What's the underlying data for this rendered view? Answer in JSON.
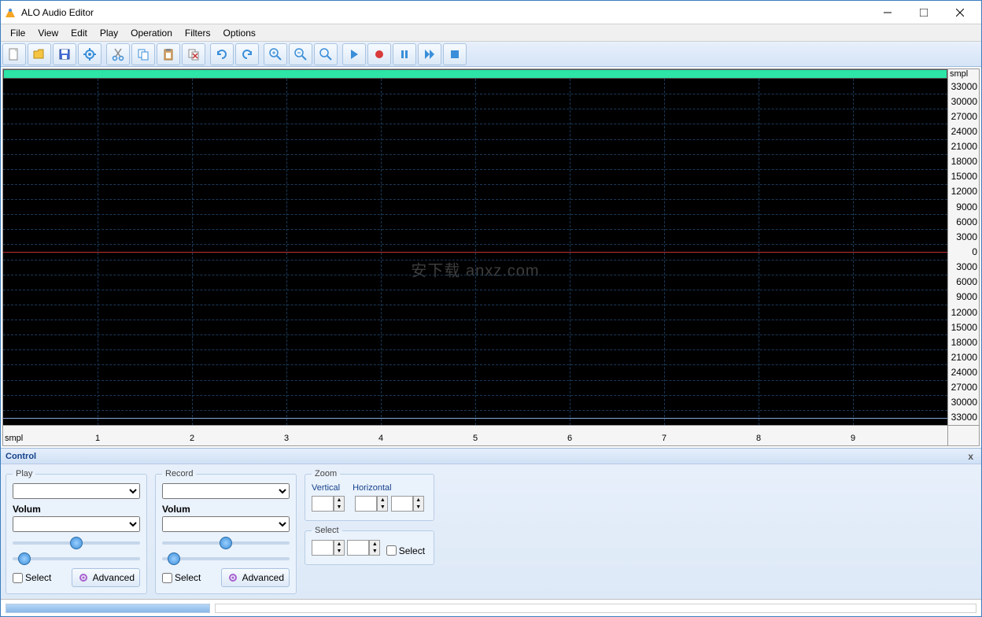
{
  "app": {
    "title": "ALO Audio Editor"
  },
  "menu": [
    "File",
    "View",
    "Edit",
    "Play",
    "Operation",
    "Filters",
    "Options"
  ],
  "toolbar_icons": [
    "new",
    "open",
    "save",
    "settings",
    "cut",
    "copy",
    "paste",
    "delete",
    "undo",
    "redo",
    "zoom-in",
    "zoom-out",
    "zoom",
    "play",
    "record",
    "pause",
    "fwd",
    "stop"
  ],
  "ruler": {
    "y_unit": "smpl",
    "y_ticks": [
      "33000",
      "30000",
      "27000",
      "24000",
      "21000",
      "18000",
      "15000",
      "12000",
      "9000",
      "6000",
      "3000",
      "0",
      "3000",
      "6000",
      "9000",
      "12000",
      "15000",
      "18000",
      "21000",
      "24000",
      "27000",
      "30000",
      "33000"
    ],
    "x_unit": "smpl",
    "x_ticks": [
      "1",
      "2",
      "3",
      "4",
      "5",
      "6",
      "7",
      "8",
      "9"
    ]
  },
  "watermark": "安下载 anxz.com",
  "control": {
    "title": "Control",
    "close": "x",
    "play": {
      "label": "Play",
      "volume": "Volum",
      "select": "Select",
      "advanced": "Advanced"
    },
    "record": {
      "label": "Record",
      "volume": "Volum",
      "select": "Select",
      "advanced": "Advanced"
    },
    "zoom": {
      "label": "Zoom",
      "vertical": "Vertical",
      "horizontal": "Horizontal"
    },
    "select": {
      "label": "Select",
      "select_chk": "Select"
    }
  }
}
